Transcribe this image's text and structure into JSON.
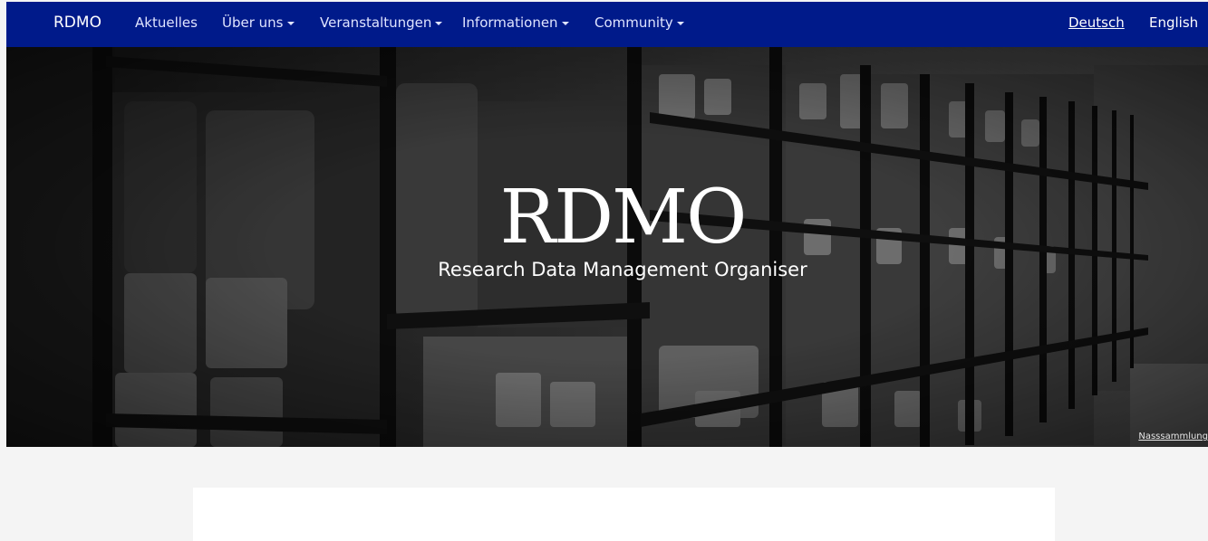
{
  "navbar": {
    "brand": "RDMO",
    "items": [
      {
        "label": "Aktuelles",
        "dropdown": false
      },
      {
        "label": "Über uns",
        "dropdown": true
      },
      {
        "label": "Veranstaltungen",
        "dropdown": true
      },
      {
        "label": "Informationen",
        "dropdown": true
      },
      {
        "label": "Community",
        "dropdown": true
      }
    ],
    "languages": [
      {
        "label": "Deutsch",
        "active": true
      },
      {
        "label": "English",
        "active": false
      }
    ],
    "background_color": "#001a8a"
  },
  "hero": {
    "title": "RDMO",
    "subtitle": "Research Data Management Organiser",
    "image_credit": "Nasssammlung"
  },
  "colors": {
    "page_background": "#f4f4f4",
    "card_background": "#ffffff",
    "hero_text": "#ffffff"
  }
}
